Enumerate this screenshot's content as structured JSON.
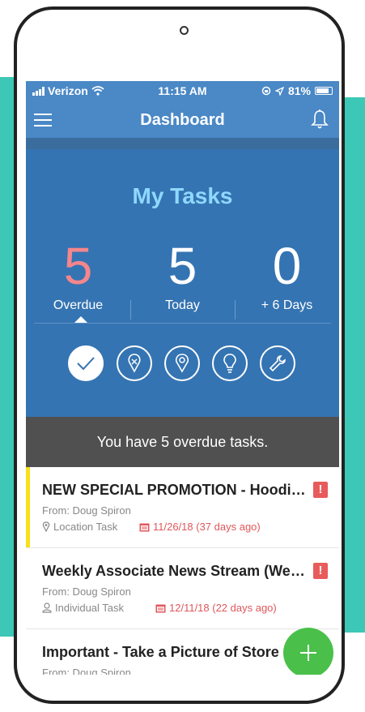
{
  "status_bar": {
    "carrier": "Verizon",
    "time": "11:15 AM",
    "battery": "81%"
  },
  "nav": {
    "title": "Dashboard"
  },
  "tasks": {
    "title": "My Tasks",
    "stats": [
      {
        "count": "5",
        "label": "Overdue"
      },
      {
        "count": "5",
        "label": "Today"
      },
      {
        "count": "0",
        "label": "+ 6 Days"
      }
    ]
  },
  "filters": [
    "check-icon",
    "location-tag-icon",
    "location-pin-icon",
    "lightbulb-icon",
    "wrench-icon"
  ],
  "banner": "You have 5 overdue tasks.",
  "task_list": [
    {
      "title": "NEW SPECIAL PROMOTION - Hoodies…",
      "from": "From:  Doug Spiron",
      "type": "Location Task",
      "date": "11/26/18 (37 days ago)"
    },
    {
      "title": "Weekly Associate News Stream (Week…",
      "from": "From:  Doug Spiron",
      "type": "Individual Task",
      "date": "12/11/18 (22 days ago)"
    },
    {
      "title": "Important - Take a Picture of Store",
      "from": "From:  Doug Spiron",
      "type": "",
      "date": ""
    }
  ],
  "colors": {
    "nav": "#4a88c6",
    "panel": "#3574b2",
    "overdue": "#f4868c",
    "banner": "#505050",
    "alert": "#e85b5b",
    "fab": "#4ac04a",
    "teal": "#3cc7b6"
  }
}
